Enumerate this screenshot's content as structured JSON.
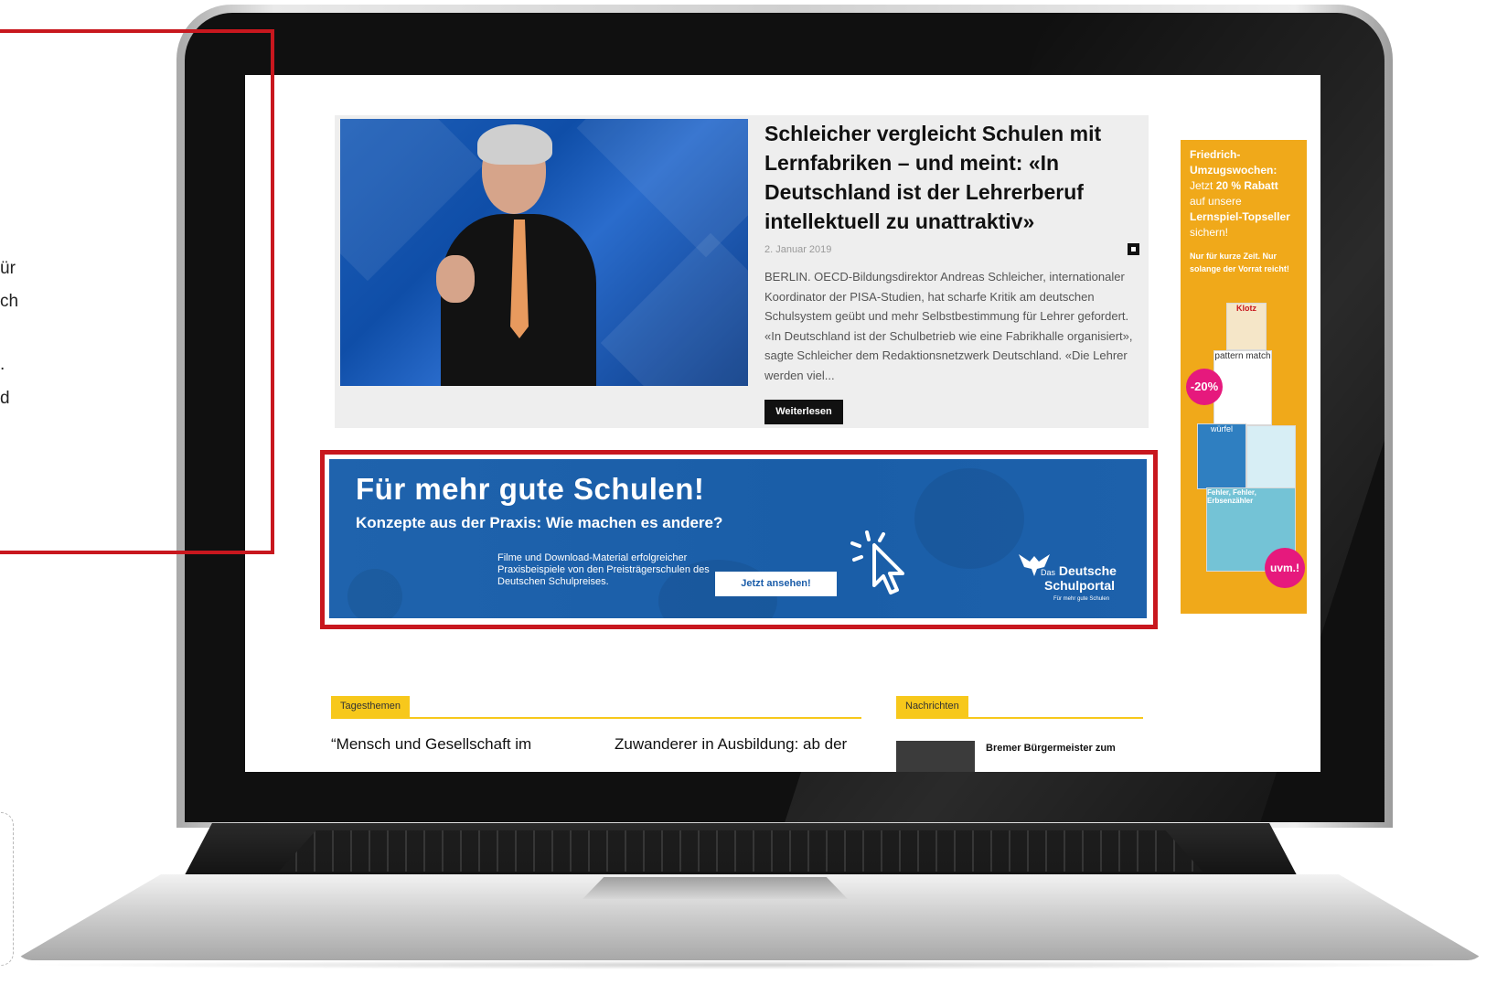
{
  "side": {
    "fragments": [
      "ür",
      "ch",
      ".",
      "d"
    ]
  },
  "article": {
    "title": "Schleicher vergleicht Schulen mit Lernfabriken – und meint: «In Deutschland ist der Lehrerberuf intellektuell zu unattraktiv»",
    "date": "2. Januar 2019",
    "body": "BERLIN. OECD-Bildungsdirektor Andreas Schleicher, internationaler Koordinator der PISA-Studien, hat scharfe Kritik am deutschen Schulsystem geübt und mehr Selbstbestimmung für Lehrer gefordert. «In Deutschland ist der Schulbetrieb wie eine Fabrikhalle organisiert», sagte Schleicher dem Redaktionsnetzwerk Deutschland. «Die Lehrer werden viel...",
    "read_more": "Weiterlesen"
  },
  "banner": {
    "title": "Für mehr gute Schulen!",
    "subtitle": "Konzepte aus der Praxis: Wie machen es andere?",
    "description": "Filme und Download-Material erfolgreicher Praxisbeispiele von den Preisträgerschulen des Deutschen Schulpreises.",
    "button": "Jetzt ansehen!",
    "logo_small": "Das",
    "logo_line1": "Deutsche",
    "logo_line2": "Schulportal",
    "logo_tagline": "Für mehr gute Schulen"
  },
  "ad": {
    "headline": "Friedrich-Umzugswochen:",
    "line_pre": "Jetzt",
    "line_bold": "20 % Rabatt",
    "line_mid": "auf unsere",
    "line_bold2": "Lernspiel-Topseller",
    "line_end": "sichern!",
    "small": "Nur für kurze Zeit. Nur solange der Vorrat reicht!",
    "badge_discount": "-20%",
    "badge_more": "uvm.!",
    "product_1": "Klotz",
    "product_2": "pattern match",
    "product_3": "würfel",
    "product_4": "Fehler, Fehler, Erbsenzähler"
  },
  "sections": {
    "tagesthemen": "Tagesthemen",
    "nachrichten": "Nachrichten",
    "teaser_1": "“Mensch und Gesellschaft im",
    "teaser_2": "Zuwanderer in Ausbildung: ab der",
    "news_1": "Bremer Bürgermeister zum"
  },
  "colors": {
    "highlight_red": "#c8171e",
    "banner_blue": "#1b5da9",
    "ad_orange": "#f0a91a",
    "section_yellow": "#f7c81b",
    "badge_pink": "#e6197d"
  }
}
